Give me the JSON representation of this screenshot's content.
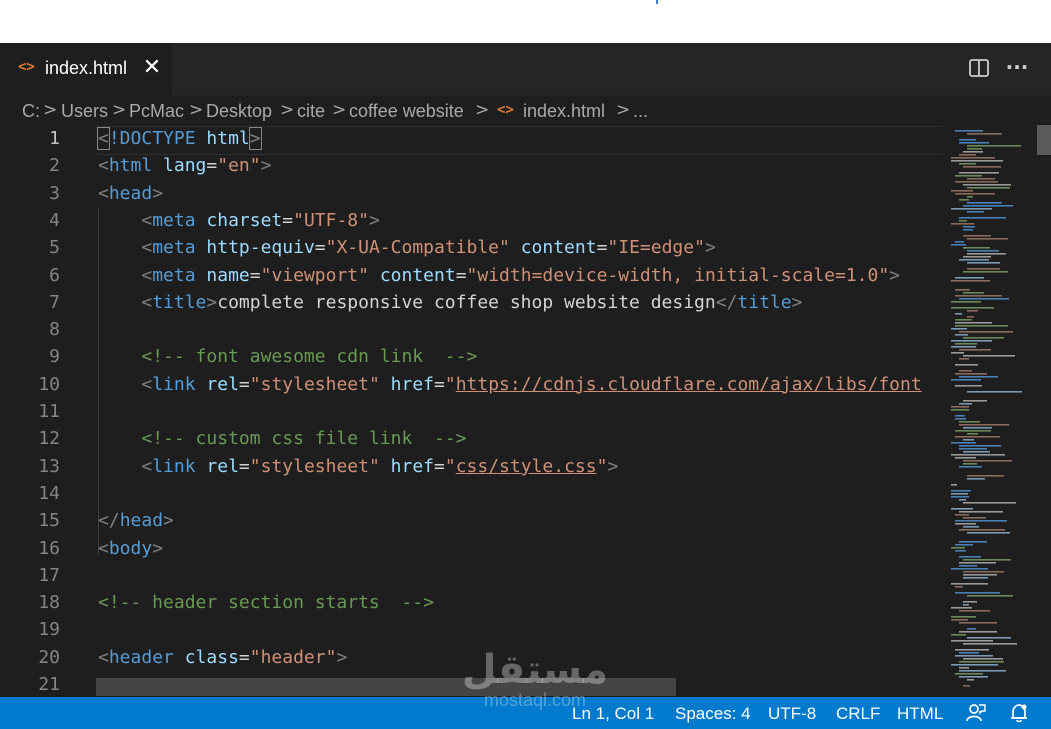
{
  "tab": {
    "label": "index.html",
    "icon": "html-file-icon",
    "close": "✕"
  },
  "toolbar": {
    "split_icon": "split-editor-icon",
    "more_icon": "more-actions-icon",
    "more_label": "···"
  },
  "breadcrumb": {
    "items": [
      "C:",
      "Users",
      "PcMac",
      "Desktop",
      "cite",
      "coffee website",
      "index.html",
      "..."
    ],
    "separator": ">"
  },
  "editor": {
    "active_line": 1,
    "line_numbers": [
      "1",
      "2",
      "3",
      "4",
      "5",
      "6",
      "7",
      "8",
      "9",
      "10",
      "11",
      "12",
      "13",
      "14",
      "15",
      "16",
      "17",
      "18",
      "19",
      "20",
      "21"
    ],
    "lines": [
      [
        [
          "br",
          "<"
        ],
        [
          "tag",
          "!DOCTYPE"
        ],
        [
          "txt",
          " "
        ],
        [
          "attr",
          "html"
        ],
        [
          "br",
          ">"
        ]
      ],
      [
        [
          "br",
          "<"
        ],
        [
          "tag",
          "html"
        ],
        [
          "txt",
          " "
        ],
        [
          "attr",
          "lang"
        ],
        [
          "txt",
          "="
        ],
        [
          "str",
          "\"en\""
        ],
        [
          "br",
          ">"
        ]
      ],
      [
        [
          "br",
          "<"
        ],
        [
          "tag",
          "head"
        ],
        [
          "br",
          ">"
        ]
      ],
      [
        [
          "txt",
          "    "
        ],
        [
          "br",
          "<"
        ],
        [
          "tag",
          "meta"
        ],
        [
          "txt",
          " "
        ],
        [
          "attr",
          "charset"
        ],
        [
          "txt",
          "="
        ],
        [
          "str",
          "\"UTF-8\""
        ],
        [
          "br",
          ">"
        ]
      ],
      [
        [
          "txt",
          "    "
        ],
        [
          "br",
          "<"
        ],
        [
          "tag",
          "meta"
        ],
        [
          "txt",
          " "
        ],
        [
          "attr",
          "http-equiv"
        ],
        [
          "txt",
          "="
        ],
        [
          "str",
          "\"X-UA-Compatible\""
        ],
        [
          "txt",
          " "
        ],
        [
          "attr",
          "content"
        ],
        [
          "txt",
          "="
        ],
        [
          "str",
          "\"IE=edge\""
        ],
        [
          "br",
          ">"
        ]
      ],
      [
        [
          "txt",
          "    "
        ],
        [
          "br",
          "<"
        ],
        [
          "tag",
          "meta"
        ],
        [
          "txt",
          " "
        ],
        [
          "attr",
          "name"
        ],
        [
          "txt",
          "="
        ],
        [
          "str",
          "\"viewport\""
        ],
        [
          "txt",
          " "
        ],
        [
          "attr",
          "content"
        ],
        [
          "txt",
          "="
        ],
        [
          "str",
          "\"width=device-width, initial-scale=1.0\""
        ],
        [
          "br",
          ">"
        ]
      ],
      [
        [
          "txt",
          "    "
        ],
        [
          "br",
          "<"
        ],
        [
          "tag",
          "title"
        ],
        [
          "br",
          ">"
        ],
        [
          "txt",
          "complete responsive coffee shop website design"
        ],
        [
          "br",
          "</"
        ],
        [
          "tag",
          "title"
        ],
        [
          "br",
          ">"
        ]
      ],
      [],
      [
        [
          "txt",
          "    "
        ],
        [
          "com",
          "<!-- font awesome cdn link  -->"
        ]
      ],
      [
        [
          "txt",
          "    "
        ],
        [
          "br",
          "<"
        ],
        [
          "tag",
          "link"
        ],
        [
          "txt",
          " "
        ],
        [
          "attr",
          "rel"
        ],
        [
          "txt",
          "="
        ],
        [
          "str",
          "\"stylesheet\""
        ],
        [
          "txt",
          " "
        ],
        [
          "attr",
          "href"
        ],
        [
          "txt",
          "="
        ],
        [
          "str",
          "\""
        ],
        [
          "link",
          "https://cdnjs.cloudflare.com/ajax/libs/font"
        ]
      ],
      [],
      [
        [
          "txt",
          "    "
        ],
        [
          "com",
          "<!-- custom css file link  -->"
        ]
      ],
      [
        [
          "txt",
          "    "
        ],
        [
          "br",
          "<"
        ],
        [
          "tag",
          "link"
        ],
        [
          "txt",
          " "
        ],
        [
          "attr",
          "rel"
        ],
        [
          "txt",
          "="
        ],
        [
          "str",
          "\"stylesheet\""
        ],
        [
          "txt",
          " "
        ],
        [
          "attr",
          "href"
        ],
        [
          "txt",
          "="
        ],
        [
          "str",
          "\""
        ],
        [
          "link",
          "css/style.css"
        ],
        [
          "str",
          "\""
        ],
        [
          "br",
          ">"
        ]
      ],
      [],
      [
        [
          "br",
          "</"
        ],
        [
          "tag",
          "head"
        ],
        [
          "br",
          ">"
        ]
      ],
      [
        [
          "br",
          "<"
        ],
        [
          "tag",
          "body"
        ],
        [
          "br",
          ">"
        ]
      ],
      [],
      [
        [
          "com",
          "<!-- header section starts  -->"
        ]
      ],
      [],
      [
        [
          "br",
          "<"
        ],
        [
          "tag",
          "header"
        ],
        [
          "txt",
          " "
        ],
        [
          "attr",
          "class"
        ],
        [
          "txt",
          "="
        ],
        [
          "str",
          "\"header\""
        ],
        [
          "br",
          ">"
        ]
      ],
      []
    ]
  },
  "status": {
    "position": "Ln 1, Col 1",
    "spaces": "Spaces: 4",
    "encoding": "UTF-8",
    "eol": "CRLF",
    "language": "HTML",
    "feedback_icon": "feedback-icon",
    "notification_icon": "bell-icon"
  },
  "watermark": {
    "arabic": "مستقل",
    "latin": "mostaql.com"
  }
}
